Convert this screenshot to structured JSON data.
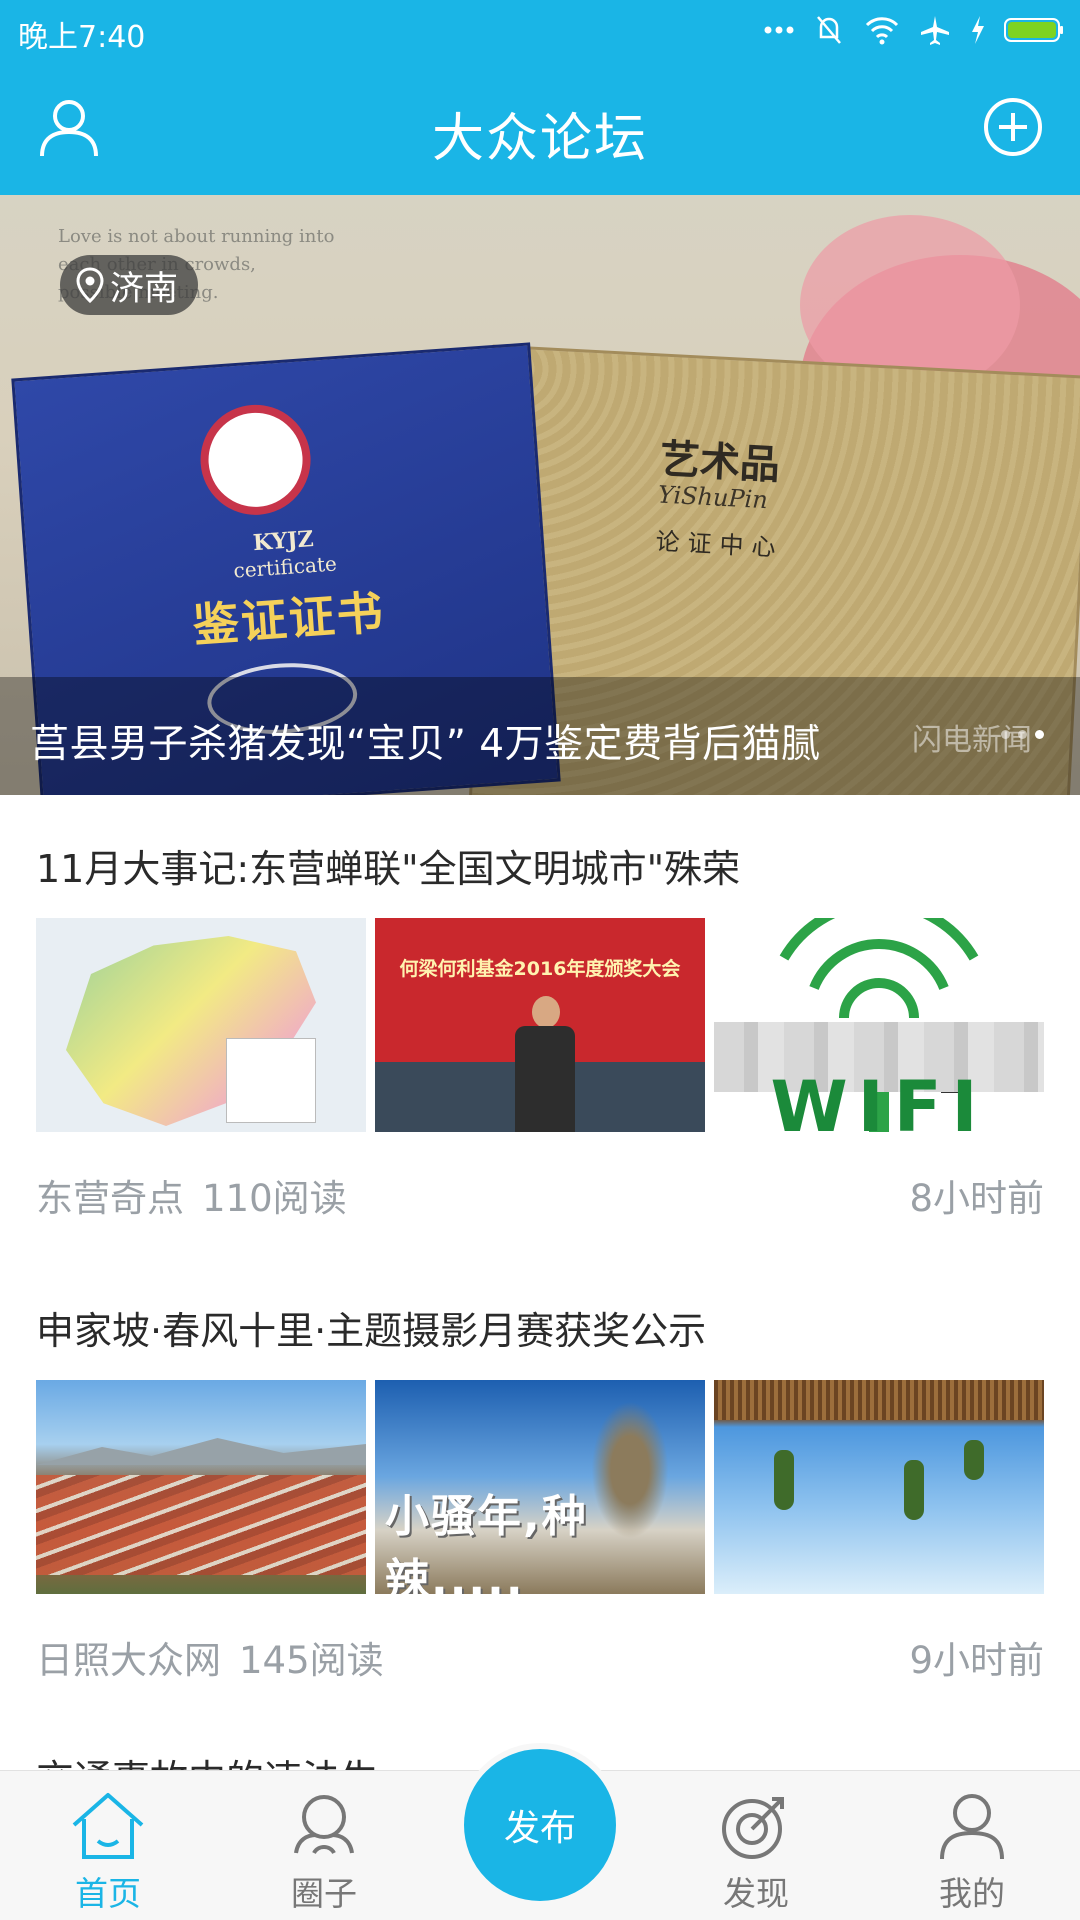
{
  "status_bar": {
    "time": "晚上7:40"
  },
  "header": {
    "title": "大众论坛"
  },
  "banner": {
    "location": "济南",
    "caption": "莒县男子杀猪发现“宝贝” 4万鉴定费背后猫腻",
    "watermark": "闪电新闻",
    "background_script": [
      "Love is not about running into",
      "each other in crowds,",
      "possible meeting."
    ],
    "book_blue": {
      "line1": "KYJZ",
      "line2": "certificate",
      "title": "鉴证证书"
    },
    "book_gold": {
      "title": "艺术品",
      "subtitle": "YiShuPin",
      "sub2": "论证中心"
    },
    "dots_count": 3
  },
  "articles": [
    {
      "title": "11月大事记:东营蝉联\"全国文明城市\"殊荣",
      "source": "东营奇点",
      "reads": "110阅读",
      "time": "8小时前",
      "thumb_texts": {
        "award_banner": "何梁何利基金2016年度颁奖大会",
        "wifi_letters": "WIFI"
      }
    },
    {
      "title": "申家坡·春风十里·主题摄影月赛获奖公示",
      "source": "日照大众网",
      "reads": "145阅读",
      "time": "9小时前",
      "thumb_texts": {
        "sign_letters": "小骚年,种辣....."
      }
    }
  ],
  "peek_article": {
    "title": "交通事故中的违法生"
  },
  "bottom_nav": {
    "home": "首页",
    "circle": "圈子",
    "publish": "发布",
    "discover": "发现",
    "mine": "我的"
  },
  "colors": {
    "brand": "#1ab5e6",
    "meta_text": "#9aa0a6"
  }
}
